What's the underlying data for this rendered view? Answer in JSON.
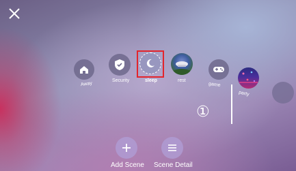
{
  "close_icon": "close-icon",
  "scenes": [
    {
      "label": "Away",
      "icon": "house-icon"
    },
    {
      "label": "Security",
      "icon": "shield-icon"
    },
    {
      "label": "sleep",
      "icon": "moon-icon"
    },
    {
      "label": "rest",
      "icon": "beach-photo-icon"
    },
    {
      "label": "game",
      "icon": "gamepad-icon"
    },
    {
      "label": "party",
      "icon": "party-photo-icon"
    },
    {
      "label": "",
      "icon": "blank-circle"
    }
  ],
  "annotation": {
    "marker": "①"
  },
  "highlight_color": "#e3242b",
  "actions": {
    "add_scene": "Add Scene",
    "scene_detail": "Scene Detail"
  }
}
